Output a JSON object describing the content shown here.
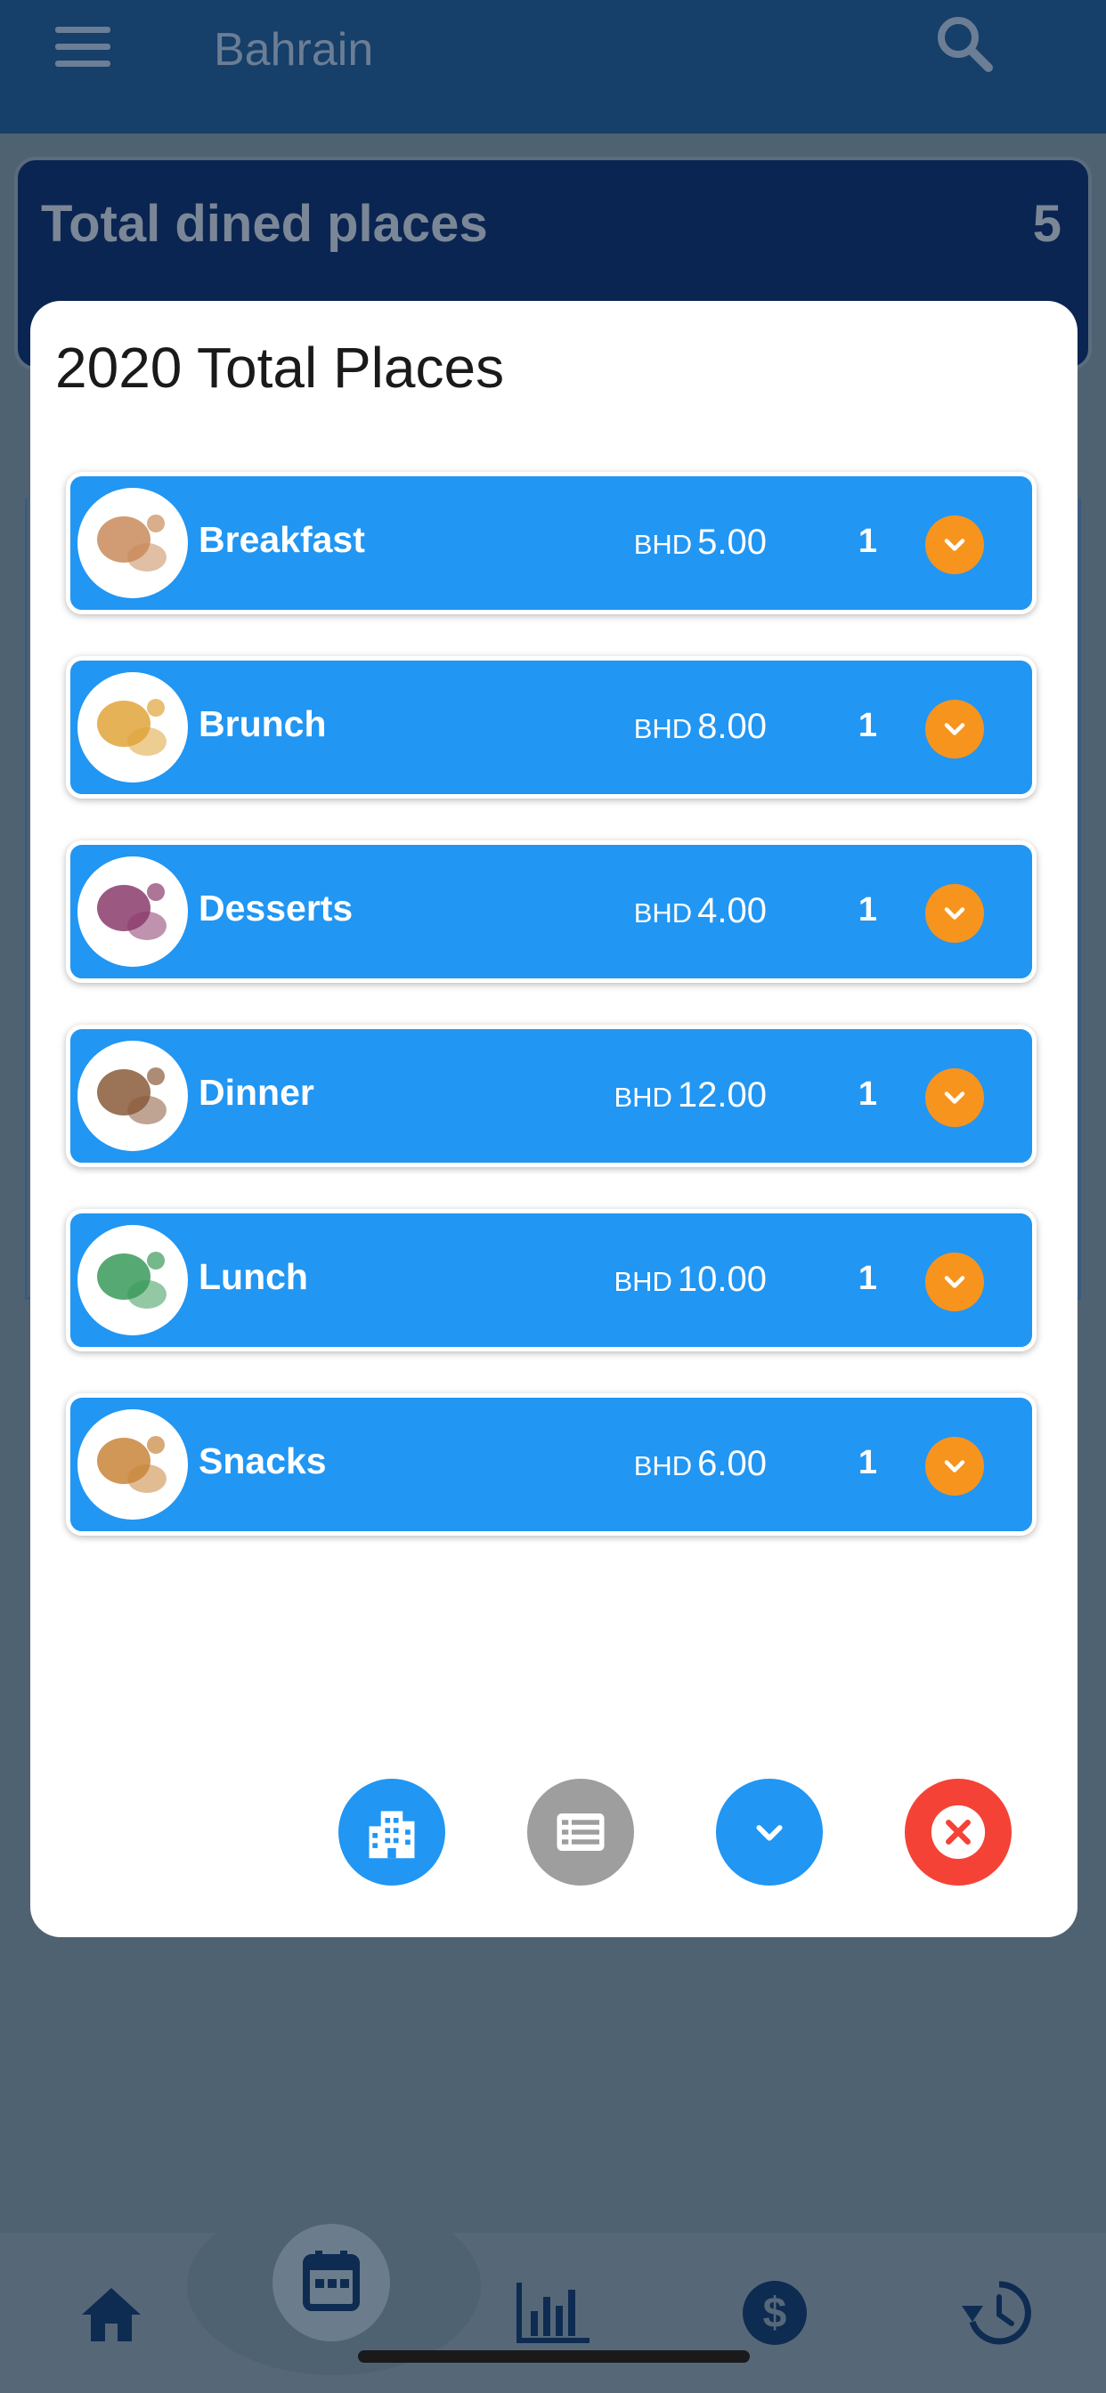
{
  "header": {
    "title": "Bahrain",
    "menu_icon": "hamburger-menu-icon",
    "search_icon": "search-icon"
  },
  "summary": {
    "label": "Total dined places",
    "count": "5"
  },
  "modal": {
    "title": "2020 Total Places",
    "items": [
      {
        "name": "Breakfast",
        "currency": "BHD",
        "amount": "5.00",
        "qty": "1",
        "thumb": "breakfast-thumbnail",
        "thumb_color": "#c98b5a"
      },
      {
        "name": "Brunch",
        "currency": "BHD",
        "amount": "8.00",
        "qty": "1",
        "thumb": "brunch-thumbnail",
        "thumb_color": "#e0a43a"
      },
      {
        "name": "Desserts",
        "currency": "BHD",
        "amount": "4.00",
        "qty": "1",
        "thumb": "desserts-thumbnail",
        "thumb_color": "#8a3b6b"
      },
      {
        "name": "Dinner",
        "currency": "BHD",
        "amount": "12.00",
        "qty": "1",
        "thumb": "dinner-thumbnail",
        "thumb_color": "#8a5a3a"
      },
      {
        "name": "Lunch",
        "currency": "BHD",
        "amount": "10.00",
        "qty": "1",
        "thumb": "lunch-thumbnail",
        "thumb_color": "#3a9a5a"
      },
      {
        "name": "Snacks",
        "currency": "BHD",
        "amount": "6.00",
        "qty": "1",
        "thumb": "snacks-thumbnail",
        "thumb_color": "#c9853a"
      }
    ],
    "actions": [
      {
        "name": "buildings-button",
        "icon": "city-buildings-icon",
        "color": "#2196f3"
      },
      {
        "name": "list-button",
        "icon": "list-icon",
        "color": "#9e9e9e"
      },
      {
        "name": "expand-button",
        "icon": "chevron-down-icon",
        "color": "#2196f3"
      },
      {
        "name": "close-button",
        "icon": "close-icon",
        "color": "#f44336"
      }
    ]
  },
  "colors": {
    "row_blue": "#2196f3",
    "toggle_orange": "#f7941d",
    "header_navy": "#163f69"
  },
  "bottom_nav": [
    {
      "name": "home",
      "icon": "home-icon"
    },
    {
      "name": "calendar",
      "icon": "calendar-icon"
    },
    {
      "name": "stats",
      "icon": "bar-chart-icon"
    },
    {
      "name": "money",
      "icon": "dollar-icon"
    },
    {
      "name": "history",
      "icon": "history-icon"
    }
  ]
}
